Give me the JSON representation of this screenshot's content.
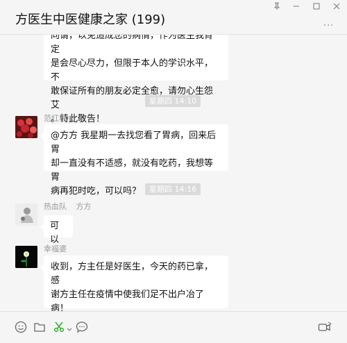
{
  "window": {
    "title": "方医生中医健康之家 (199)",
    "controls": [
      "pin-icon",
      "minimize-icon",
      "maximize-icon",
      "close-icon"
    ],
    "more_label": "···"
  },
  "messages": [
    {
      "type": "text",
      "sender_visible": false,
      "lines": [
        "向请，以免造成您的病情，作为医生我肯定",
        "是会尽心尽力，但限于本人的学识水平，不",
        "敢保证所有的朋友必定全愈，请勿心生怨艾",
        "。特此敬告！"
      ]
    },
    {
      "type": "timestamp",
      "text": "星期四 14:10"
    },
    {
      "type": "text",
      "sender": "范红艳",
      "avatar": "red-flowers-avatar",
      "lines": [
        "@方方 我星期一去找您看了胃病，回来后胃",
        "却一直没有不适感，就没有吃药，我想等胃",
        "病再犯时吃，可以吗？"
      ]
    },
    {
      "type": "timestamp",
      "text": "星期四 14:16"
    },
    {
      "type": "text",
      "sender": "热血队",
      "sender_sub": "方方",
      "avatar": "white-figure-avatar",
      "lines": [
        "可以"
      ]
    },
    {
      "type": "text",
      "sender": "幸福婆",
      "avatar": "dark-flower-avatar",
      "lines": [
        "收到，方主任是好医生，今天的药已拿，感",
        "谢方主任在疫情中使我们足不出户冶了病！"
      ],
      "emojis": [
        "🌹",
        "👍",
        "👍",
        "👍",
        "🤝"
      ]
    }
  ],
  "toolbar": {
    "items": [
      "emoji-icon",
      "folder-icon",
      "scissors-icon",
      "chat-bubble-icon"
    ],
    "right_item": "video-call-icon",
    "accent": "#1aad19"
  }
}
